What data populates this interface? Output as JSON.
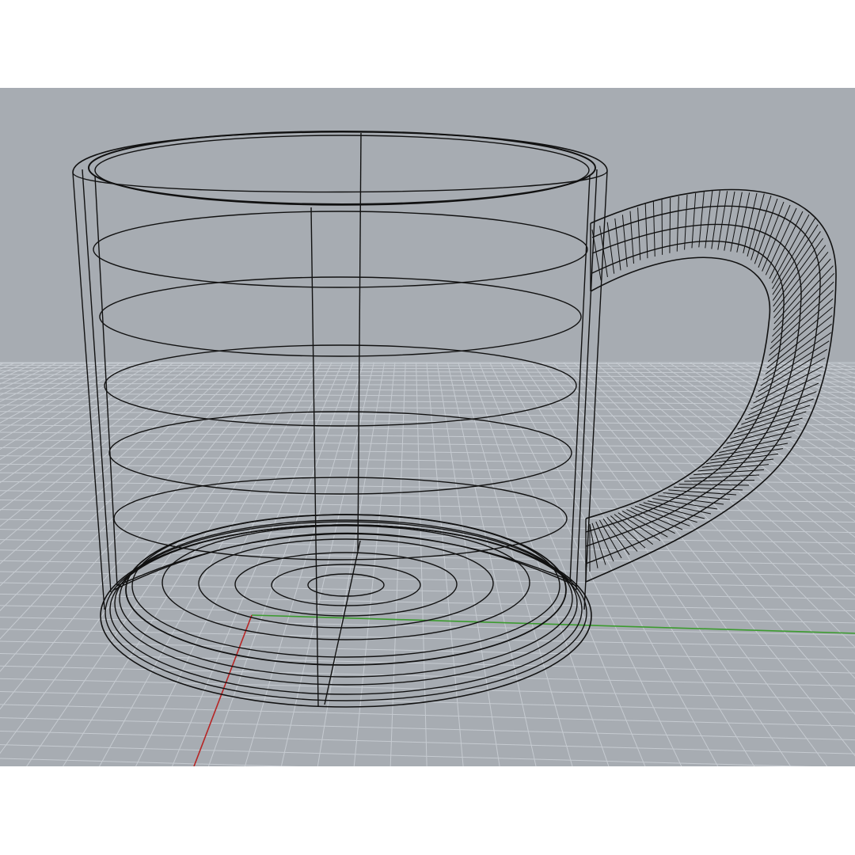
{
  "viewport": {
    "display_mode": "wireframe",
    "background_color": "#a7acb2",
    "grid_color": "#c6cbd1",
    "grid_major_color": "#b9bec4",
    "x_axis_color": "#3c9b2f",
    "y_axis_color": "#b62525",
    "wire_color": "#111111",
    "page_background": "#ffffff"
  },
  "model": {
    "object": "mug-wireframe",
    "icon": "cursor-icon"
  }
}
